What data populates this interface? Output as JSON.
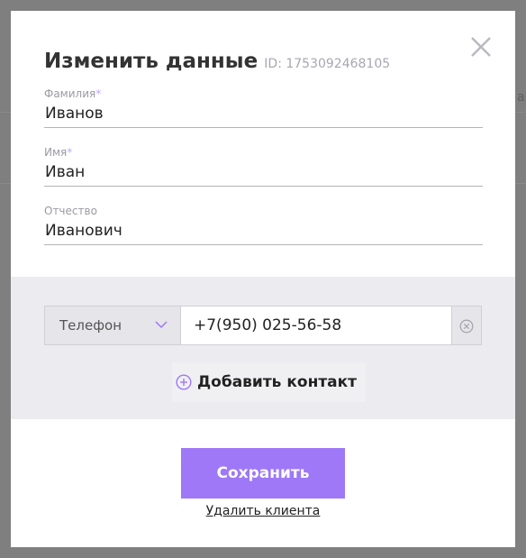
{
  "background": {
    "side_text": "ак"
  },
  "modal": {
    "title": "Изменить данные",
    "client_id": "ID: 1753092468105"
  },
  "fields": {
    "last_name": {
      "label": "Фамилия",
      "required_mark": "*",
      "value": "Иванов"
    },
    "first_name": {
      "label": "Имя",
      "required_mark": "*",
      "value": "Иван"
    },
    "middle_name": {
      "label": "Отчество",
      "value": "Иванович"
    }
  },
  "contacts": {
    "type_selected": "Телефон",
    "phone_value": "+7(950) 025-56-58",
    "add_label": "Добавить контакт"
  },
  "actions": {
    "save_label": "Сохранить",
    "delete_label": "Удалить клиента"
  },
  "colors": {
    "accent": "#9e78f7",
    "overlay": "#7f7f7f",
    "section_bg": "#ebebf0"
  }
}
